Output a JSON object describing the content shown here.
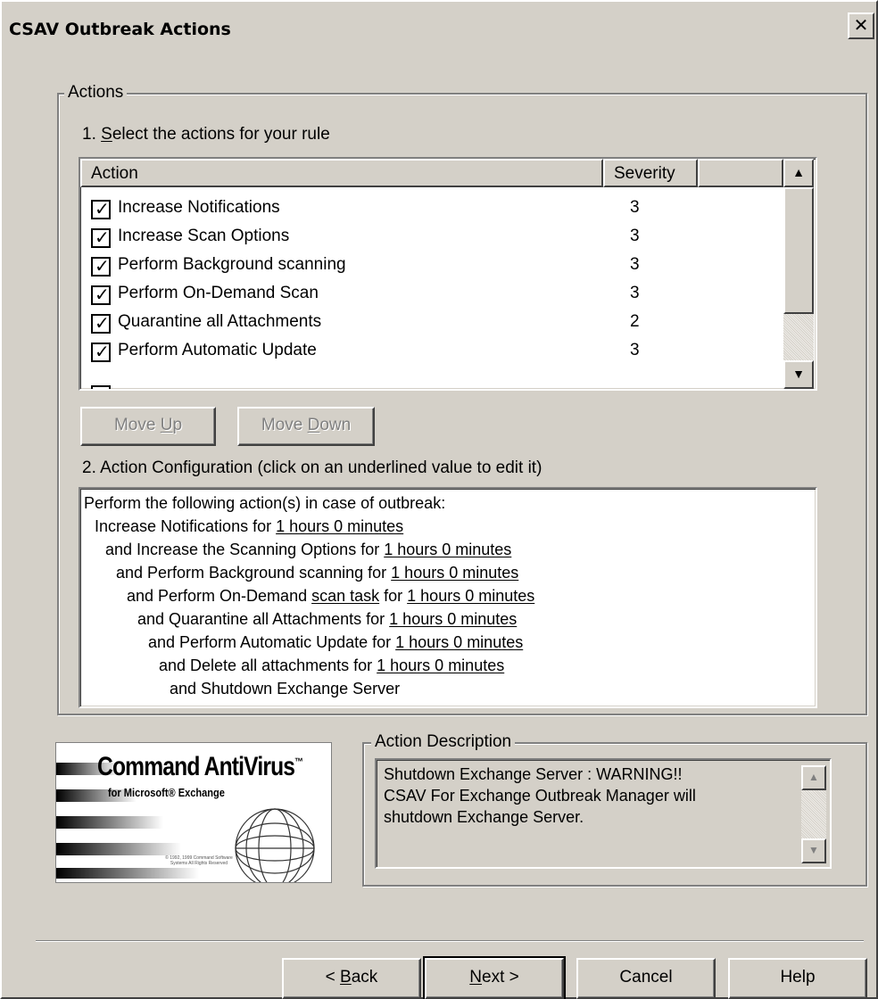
{
  "window": {
    "title": "CSAV Outbreak Actions",
    "close_glyph": "✕"
  },
  "actions_group": {
    "legend": "Actions",
    "step1_prefix": "1. ",
    "step1_underline": "S",
    "step1_rest": "elect the actions for your rule",
    "columns": {
      "action": "Action",
      "severity": "Severity"
    },
    "rows": [
      {
        "action": "Increase Notifications",
        "severity": "3",
        "checked": true
      },
      {
        "action": "Increase Scan Options",
        "severity": "3",
        "checked": true
      },
      {
        "action": "Perform Background scanning",
        "severity": "3",
        "checked": true
      },
      {
        "action": "Perform On-Demand Scan",
        "severity": "3",
        "checked": true
      },
      {
        "action": "Quarantine all Attachments",
        "severity": "2",
        "checked": true
      },
      {
        "action": "Perform Automatic Update",
        "severity": "3",
        "checked": true
      }
    ],
    "move_up": {
      "pre": "Move ",
      "ul": "U",
      "post": "p"
    },
    "move_down": {
      "pre": "Move ",
      "ul": "D",
      "post": "own"
    },
    "step2_label": "2. Action Configuration (click on an underlined value to edit it)"
  },
  "config": {
    "lines": [
      {
        "pre": "Perform the following action(s) in case of outbreak:",
        "link": "",
        "mid": "",
        "link2": ""
      },
      {
        "pre": "Increase Notifications for ",
        "link": "1 hours 0 minutes",
        "mid": "",
        "link2": ""
      },
      {
        "pre": "and Increase the Scanning Options for ",
        "link": "1 hours 0 minutes",
        "mid": "",
        "link2": ""
      },
      {
        "pre": "and Perform Background scanning for ",
        "link": "1 hours 0 minutes",
        "mid": "",
        "link2": ""
      },
      {
        "pre": "and Perform On-Demand ",
        "link": "scan task",
        "mid": " for ",
        "link2": "1 hours 0 minutes"
      },
      {
        "pre": "and Quarantine all Attachments for  ",
        "link": "1 hours 0 minutes",
        "mid": "",
        "link2": ""
      },
      {
        "pre": "and Perform Automatic Update for ",
        "link": "1 hours 0 minutes",
        "mid": "",
        "link2": ""
      },
      {
        "pre": "and Delete all attachments for ",
        "link": "1 hours 0 minutes",
        "mid": "",
        "link2": ""
      },
      {
        "pre": "and Shutdown Exchange Server",
        "link": "",
        "mid": "",
        "link2": ""
      }
    ]
  },
  "logo": {
    "brand": "Command AntiVirus",
    "tm": "™",
    "sub": "for Microsoft® Exchange",
    "fine_print": "© 1992, 1999 Command Software Systems All Rights Reserved"
  },
  "description": {
    "legend": "Action Description",
    "lines": [
      "Shutdown Exchange Server : WARNING!!",
      "CSAV For Exchange Outbreak Manager will",
      "shutdown Exchange Server."
    ]
  },
  "footer": {
    "back": {
      "pre": "< ",
      "ul": "B",
      "post": "ack"
    },
    "next": {
      "pre": "",
      "ul": "N",
      "post": "ext >"
    },
    "cancel": "Cancel",
    "help": "Help"
  }
}
